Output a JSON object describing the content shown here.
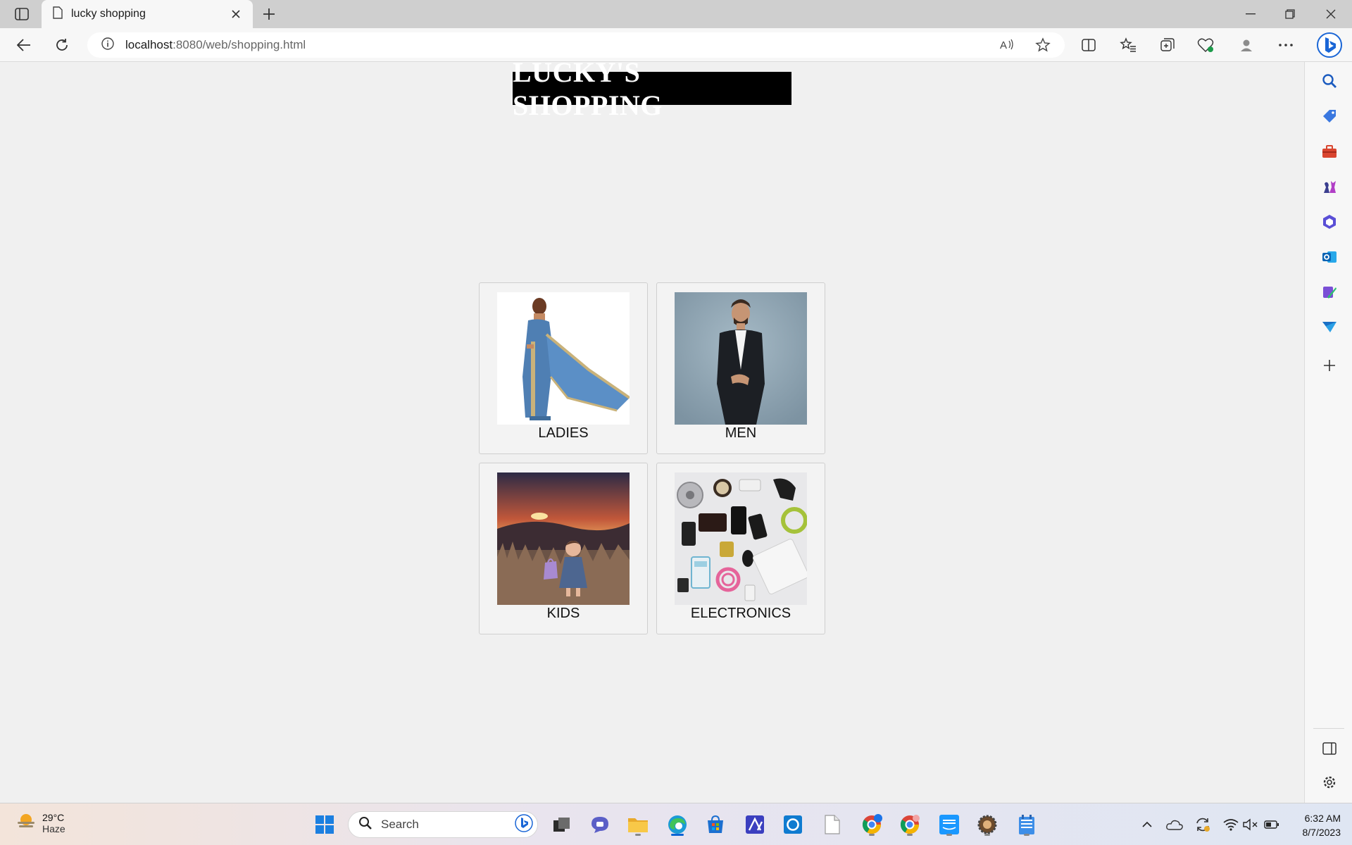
{
  "browser": {
    "tab_title": "lucky shopping",
    "url_host": "localhost",
    "url_rest": ":8080/web/shopping.html"
  },
  "page": {
    "title": "LUCKY'S SHOPPING",
    "categories": [
      {
        "label": "LADIES"
      },
      {
        "label": "MEN"
      },
      {
        "label": "KIDS"
      },
      {
        "label": "ELECTRONICS"
      }
    ]
  },
  "taskbar": {
    "weather_temp": "29°C",
    "weather_desc": "Haze",
    "search_label": "Search",
    "time": "6:32 AM",
    "date": "8/7/2023"
  },
  "colors": {
    "accent": "#0a64d4",
    "title_bg": "#000000",
    "title_fg": "#ffffff"
  }
}
